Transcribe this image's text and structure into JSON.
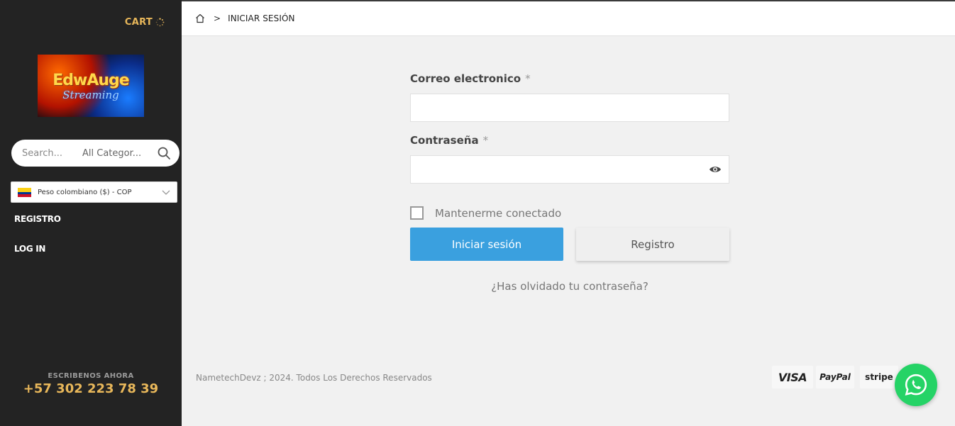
{
  "sidebar": {
    "cart_label": "CART",
    "logo": {
      "brand": "EdwAuge",
      "sub": "Streaming"
    },
    "search": {
      "placeholder": "Search...",
      "category": "All Categor..."
    },
    "currency": {
      "label": "Peso colombiano ($) - COP"
    },
    "nav": [
      {
        "label": "REGISTRO"
      },
      {
        "label": "LOG IN"
      }
    ],
    "contact": {
      "label": "ESCRIBENOS AHORA",
      "phone": "+57 302 223 78 39"
    }
  },
  "breadcrumb": {
    "separator": ">",
    "current": "INICIAR SESIÓN"
  },
  "form": {
    "email_label": "Correo electronico",
    "password_label": "Contraseña",
    "required_mark": "*",
    "remember_label": "Mantenerme conectado",
    "login_button": "Iniciar sesión",
    "register_button": "Registro",
    "forgot_link": "¿Has olvidado tu contraseña?"
  },
  "footer": {
    "copyright": "NametechDevz ; 2024. Todos Los Derechos Reservados",
    "payments": [
      "VISA",
      "PayPal",
      "stripe"
    ]
  },
  "colors": {
    "sidebar_bg": "#232323",
    "accent_gold": "#e8b75a",
    "primary_button": "#3aa0df",
    "whatsapp": "#25d366"
  },
  "icons": [
    "spinner-icon",
    "search-icon",
    "colombia-flag-icon",
    "chevron-down-icon",
    "home-icon",
    "eye-icon",
    "whatsapp-icon"
  ]
}
